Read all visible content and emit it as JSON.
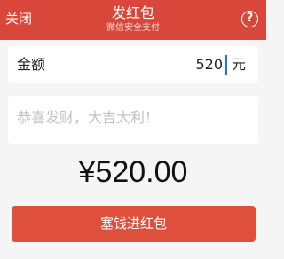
{
  "header": {
    "close_label": "关闭",
    "title": "发红包",
    "subtitle": "微信安全支付",
    "help_glyph": "?",
    "help_icon": "question-circle-icon",
    "background_color": "#d9473a"
  },
  "amount": {
    "label": "金额",
    "value": "520",
    "unit": "元"
  },
  "message": {
    "placeholder": "恭喜发财，大吉大利！"
  },
  "total": {
    "display": "¥520.00"
  },
  "submit": {
    "label": "塞钱进红包",
    "color": "#de4f3c"
  }
}
